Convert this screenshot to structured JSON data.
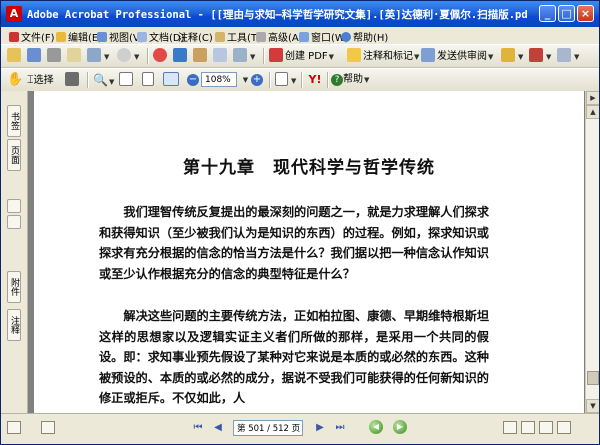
{
  "window": {
    "title": "Adobe Acrobat Professional - [[理由与求知—科学哲学研究文集].[英]达德利·夏佩尔.扫描版.pdf]",
    "minimize_label": "_",
    "maximize_label": "□",
    "close_label": "×",
    "app_icon_letter": "A"
  },
  "menu": {
    "items": [
      {
        "label": "文件(F)",
        "icon": "file-icon"
      },
      {
        "label": "编辑(E)",
        "icon": "edit-icon"
      },
      {
        "label": "视图(V)",
        "icon": "view-icon"
      },
      {
        "label": "文档(D)",
        "icon": "document-icon"
      },
      {
        "label": "注释(C)",
        "icon": "comment-icon"
      },
      {
        "label": "工具(T)",
        "icon": "tools-icon"
      },
      {
        "label": "高级(A)",
        "icon": "advanced-icon"
      },
      {
        "label": "窗口(W)",
        "icon": "window-icon"
      },
      {
        "label": "帮助(H)",
        "icon": "help-icon"
      }
    ]
  },
  "toolbar1": {
    "create_pdf_label": "创建 PDF",
    "comment_mark_label": "注释和标记",
    "send_review_label": "发送供审阅"
  },
  "toolbar2": {
    "select_label": "选择",
    "zoom_value": "108%",
    "help_label": "帮助"
  },
  "side_tabs": {
    "bookmarks": "书签",
    "pages": "页面",
    "attachments": "附件",
    "comments": "注释"
  },
  "document": {
    "chapter_title": "第十九章　现代科学与哲学传统",
    "paragraph1": "我们理智传统反复提出的最深刻的问题之一，就是力求理解人们探求和获得知识（至少被我们认为是知识的东西）的过程。例如，探求知识或探求有充分根据的信念的恰当方法是什么？我们据以把一种信念认作知识或至少认作根据充分的信念的典型特征是什么？",
    "paragraph2": "解决这些问题的主要传统方法，正如柏拉图、康德、早期维特根斯坦这样的思想家以及逻辑实证主义者们所做的那样，是采用一个共同的假设。即：求知事业预先假设了某种对它来说是本质的或必然的东西。这种被预设的、本质的或必然的成分，据说不受我们可能获得的任何新知识的修正或拒斥。不仅如此，人"
  },
  "navigation": {
    "page_display": "第 501 / 512 页",
    "current_page": 501,
    "total_pages": 512
  },
  "colors": {
    "titlebar": "#1f62d6",
    "toolbar": "#ece9d8",
    "doc_background": "#808080"
  }
}
